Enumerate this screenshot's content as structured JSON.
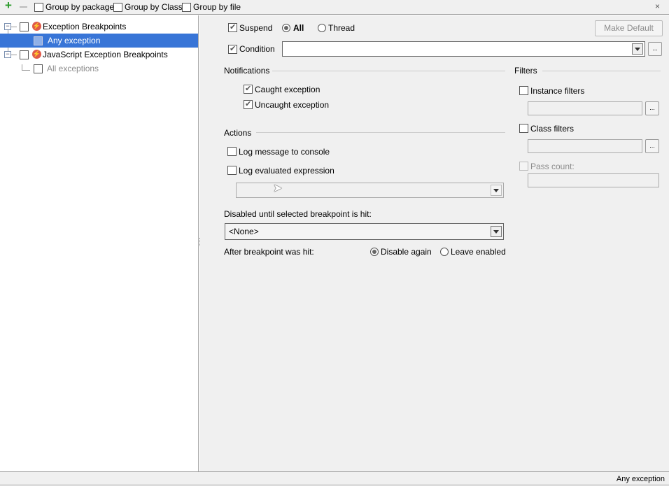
{
  "toolbar": {
    "add_icon": "plus-icon",
    "remove_icon": "minus-icon",
    "group_by_package": "Group by package",
    "group_by_class": "Group by Class",
    "group_by_file": "Group by file",
    "close_icon": "close-icon"
  },
  "tree": [
    {
      "label": "Exception Breakpoints",
      "icon": "lightning-icon"
    },
    {
      "label": "Any exception",
      "selected": true
    },
    {
      "label": "JavaScript Exception Breakpoints",
      "icon": "lightning-icon"
    },
    {
      "label": "All exceptions",
      "disabled": true
    }
  ],
  "colors": {
    "selection": "#3875d7",
    "panel_bg": "#f0f0f0",
    "disabled_text": "#8c8c8c"
  },
  "details": {
    "suspend": "Suspend",
    "all": "All",
    "thread": "Thread",
    "make_default": "Make Default",
    "condition": "Condition",
    "condition_value": "",
    "notifications": "Notifications",
    "caught": "Caught exception",
    "uncaught": "Uncaught exception",
    "actions": "Actions",
    "log_message": "Log message to console",
    "log_expression": "Log evaluated expression",
    "disabled_until": "Disabled until selected breakpoint is hit:",
    "disabled_until_value": "<None>",
    "after_hit": "After breakpoint was hit:",
    "disable_again": "Disable again",
    "leave_enabled": "Leave enabled",
    "filters": "Filters",
    "instance_filters": "Instance filters",
    "class_filters": "Class filters",
    "pass_count": "Pass count:",
    "ellipsis": "..."
  },
  "status": {
    "text": "Any exception"
  }
}
